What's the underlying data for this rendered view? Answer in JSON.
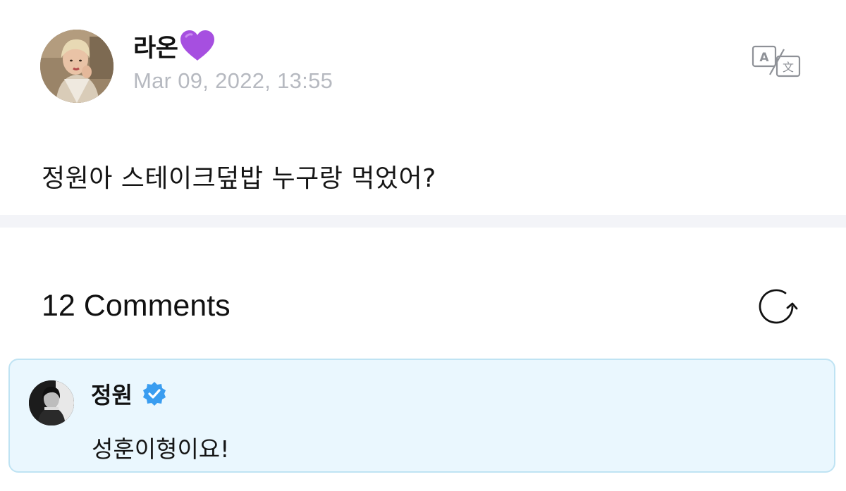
{
  "post": {
    "author": "라온",
    "author_icon": "purple-heart-icon",
    "date": "Mar 09, 2022, 13:55",
    "text": "정원아 스테이크덮밥 누구랑 먹었어?",
    "translate_icon": "translate-icon"
  },
  "comments": {
    "count_label": "12 Comments",
    "refresh_icon": "refresh-icon",
    "items": [
      {
        "author": "정원",
        "badge_icon": "verified-badge-icon",
        "text": "성훈이형이요!"
      }
    ]
  },
  "colors": {
    "date_gray": "#b6b9c0",
    "divider": "#f3f4f8",
    "comment_bg": "#eaf7fe",
    "comment_border": "#bfe3f3",
    "heart_purple": "#a64fe0",
    "verified_blue": "#3a9df0"
  }
}
